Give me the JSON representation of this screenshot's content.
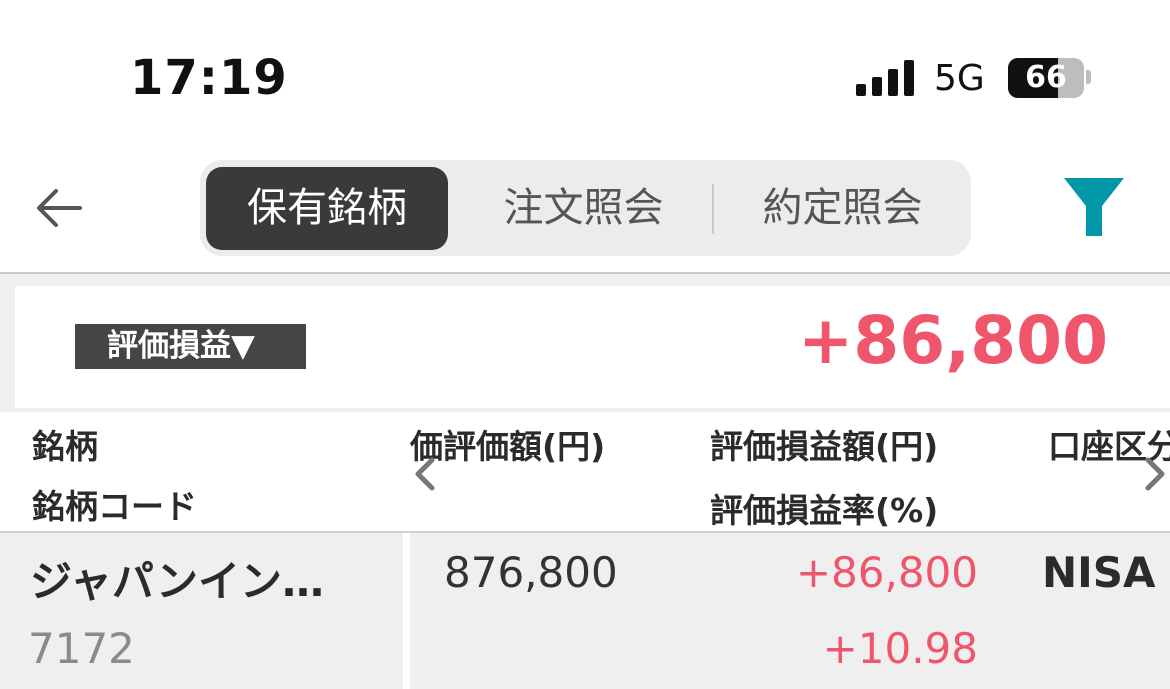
{
  "status_bar": {
    "time": "17:19",
    "network": "5G",
    "battery": "66"
  },
  "header": {
    "tabs": [
      {
        "label": "保有銘柄",
        "active": true
      },
      {
        "label": "注文照会",
        "active": false
      },
      {
        "label": "約定照会",
        "active": false
      }
    ],
    "filter_color": "#0097a7"
  },
  "summary": {
    "selector_label": "評価損益▼",
    "value": "+86,800",
    "value_color": "#f0566b"
  },
  "table": {
    "columns": {
      "name": "銘柄",
      "code": "銘柄コード",
      "valuation": "価評価額(円)",
      "pl_amount": "評価損益額(円)",
      "pl_rate": "評価損益率(%)",
      "account": "口座区分"
    },
    "rows": [
      {
        "name": "ジャパンイン…",
        "code": "7172",
        "valuation": "876,800",
        "pl_amount": "+86,800",
        "pl_rate": "+10.98",
        "account": "NISA"
      }
    ]
  }
}
